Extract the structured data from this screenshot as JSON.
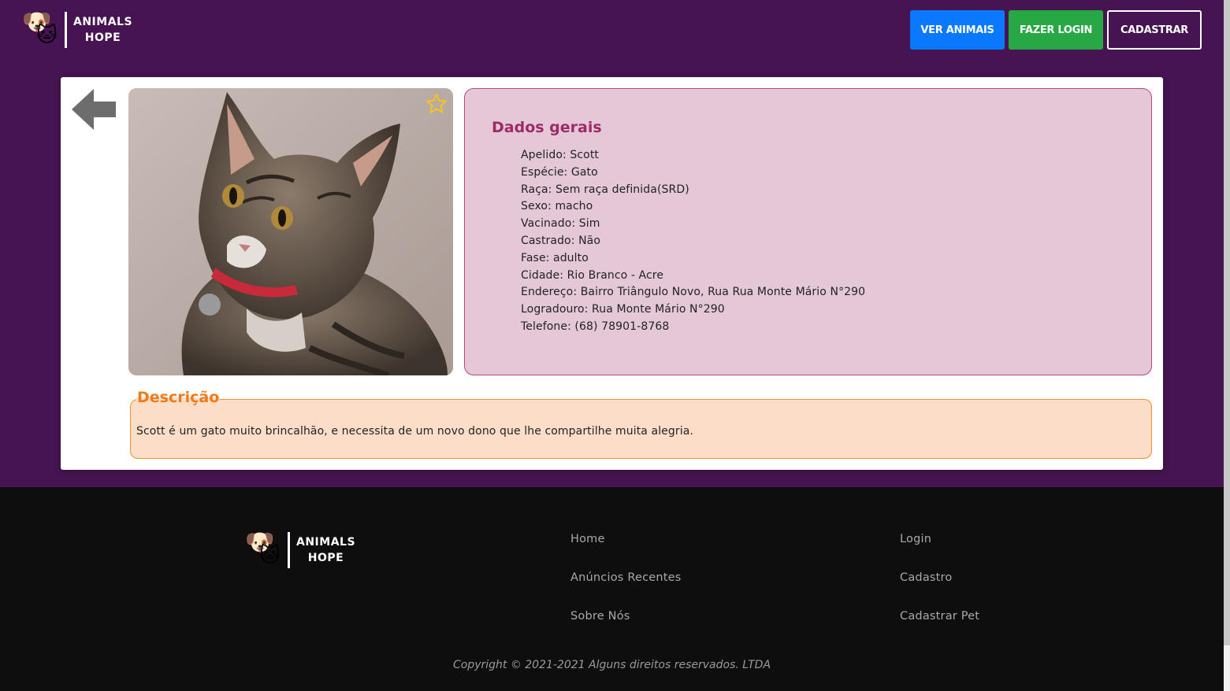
{
  "brand": {
    "line1": "ANIMALS",
    "line2": "HOPE",
    "dog_emoji": "🐶",
    "cat_emoji": "🐱"
  },
  "nav": {
    "ver_animais": "VER ANIMAIS",
    "fazer_login": "FAZER LOGIN",
    "cadastrar": "CADASTRAR"
  },
  "colors": {
    "background": "#471452",
    "btn_blue": "#0a79ff",
    "btn_green": "#27a844",
    "info_title": "#9e2b66",
    "desc_title": "#ef7a17",
    "favorite_star": "#f5c518"
  },
  "icons": {
    "back": "arrow-left-icon",
    "favorite": "star-outline-icon"
  },
  "pet": {
    "info_title": "Dados gerais",
    "fields": [
      "Apelido: Scott",
      "Espécie: Gato",
      "Raça: Sem raça definida(SRD)",
      "Sexo: macho",
      "Vacinado: Sim",
      "Castrado: Não",
      "Fase: adulto",
      "Cidade: Rio Branco - Acre",
      "Endereço: Bairro Triângulo Novo, Rua Rua Monte Mário N°290",
      "Logradouro: Rua Monte Mário N°290",
      "Telefone: (68) 78901-8768"
    ],
    "description_title": "Descrição",
    "description": "Scott é um gato muito brincalhão, e necessita de um novo dono que lhe compartilhe muita alegria."
  },
  "footer": {
    "col1": [
      "Home",
      "Anúncios Recentes",
      "Sobre Nós"
    ],
    "col2": [
      "Login",
      "Cadastro",
      "Cadastrar Pet"
    ],
    "copyright": "Copyright © 2021-2021 Alguns direitos reservados. LTDA"
  }
}
